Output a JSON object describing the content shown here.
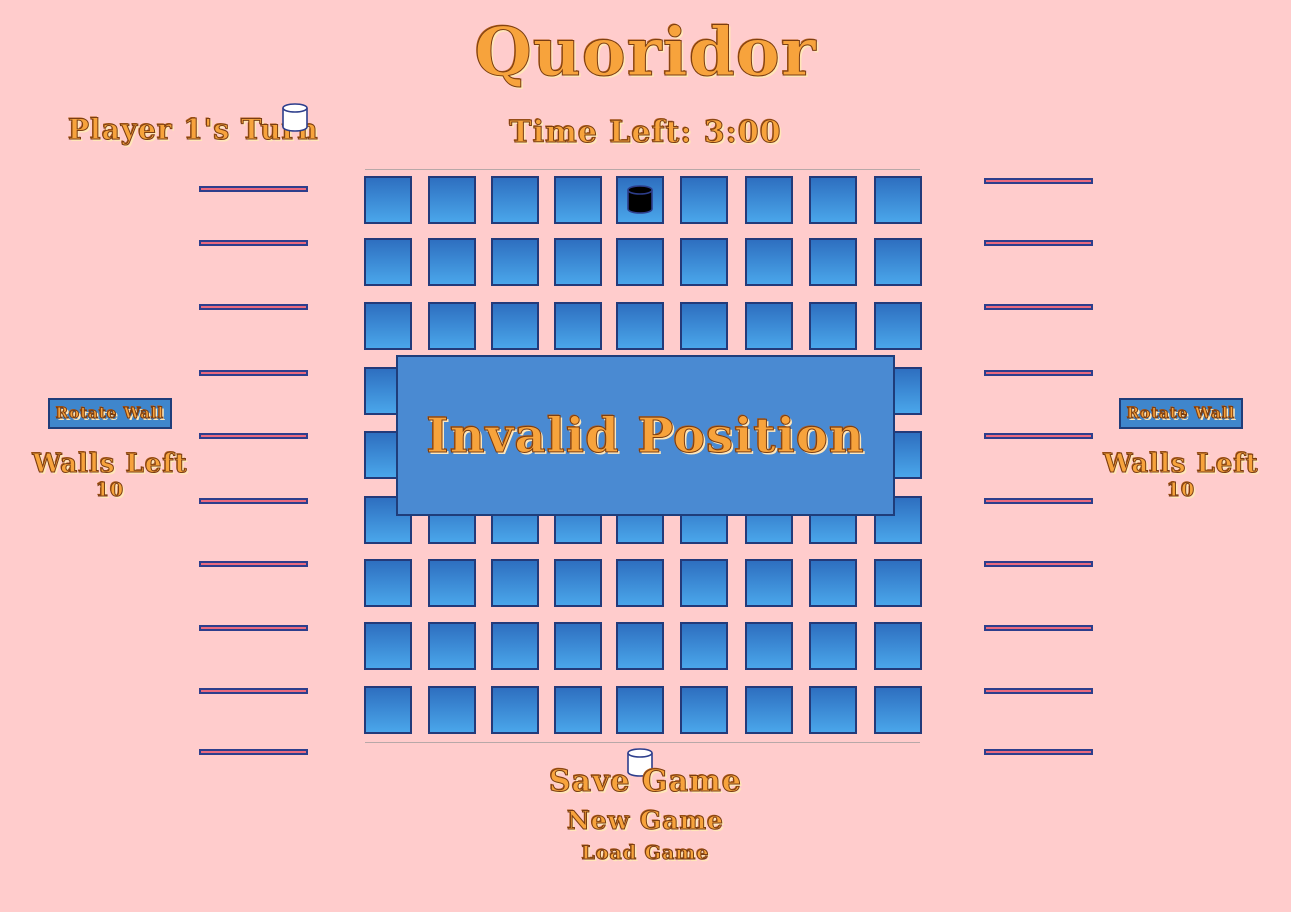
{
  "title": "Quoridor",
  "turn_text": "Player 1's Turn",
  "timer_text": "Time Left: 3:00",
  "left_panel": {
    "rotate_label": "Rotate Wall",
    "walls_label": "Walls Left",
    "walls_count": "10"
  },
  "right_panel": {
    "rotate_label": "Rotate Wall",
    "walls_label": "Walls Left",
    "walls_count": "10"
  },
  "board": {
    "rows": 9,
    "cols": 9
  },
  "pawns": [
    {
      "player": 1,
      "color": "#ffffff",
      "row": 9,
      "col": 5
    },
    {
      "player": 2,
      "color": "#000000",
      "row": 1,
      "col": 5
    }
  ],
  "modal": {
    "text": "Invalid Position"
  },
  "menu": {
    "save": "Save Game",
    "new": "New Game",
    "load": "Load Game"
  },
  "colors": {
    "background": "#ffcccc",
    "title_orange": "#f7a33c",
    "cell_blue": "#3a8ad8",
    "wall_pink": "#ea6a7e",
    "wall_border": "#2d3e8c",
    "modal_blue": "#4a8ad2"
  }
}
